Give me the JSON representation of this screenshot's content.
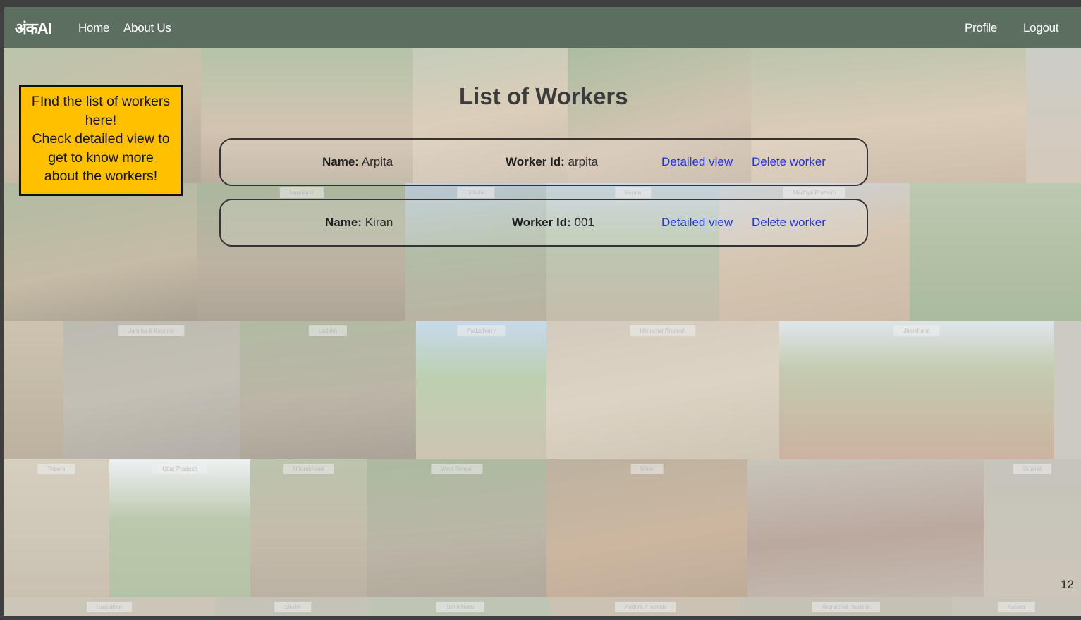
{
  "navbar": {
    "brand": "अंकAI",
    "links": [
      "Home",
      "About Us"
    ],
    "right_links": [
      "Profile",
      "Logout"
    ]
  },
  "page": {
    "title": "List of Workers"
  },
  "callout": {
    "lines": [
      "FInd the list of workers",
      "here!",
      "Check detailed view to",
      "get to know more",
      "about the workers!"
    ]
  },
  "workers": [
    {
      "name_label": "Name:",
      "name": "Arpita",
      "id_label": "Worker Id:",
      "id": "arpita",
      "detailed_label": "Detailed view",
      "delete_label": "Delete worker"
    },
    {
      "name_label": "Name:",
      "name": "Kiran",
      "id_label": "Worker Id:",
      "id": "001",
      "detailed_label": "Detailed view",
      "delete_label": "Delete worker"
    }
  ],
  "background_labels": [
    "Nagaland",
    "Odisha",
    "Kerala",
    "Madhya Pradesh",
    "Jammu & Kashmir",
    "Ladakh",
    "Puducherry",
    "Himachal Pradesh",
    "Jharkhand",
    "Tripura",
    "Uttar Pradesh",
    "Uttarakhand",
    "West Bengal",
    "Bihar",
    "Gujarat",
    "Rajasthan",
    "Sikkim",
    "Tamil Nadu",
    "Andhra Pradesh",
    "Arunachal Pradesh",
    "Assam"
  ],
  "slide_number": "12",
  "colors": {
    "navbar": "#5b6e60",
    "callout": "#ffc000",
    "link": "#1f35d8"
  }
}
